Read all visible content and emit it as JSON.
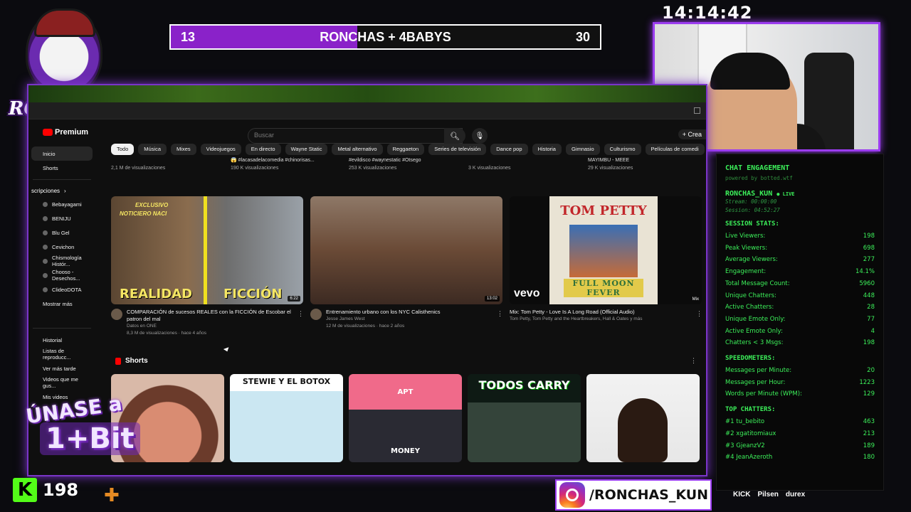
{
  "overlay": {
    "clock": "14:14:42",
    "score": {
      "left": "13",
      "title": "RONCHAS + 4BABYS",
      "right": "30"
    },
    "logo_text": "RONCHAS",
    "join_line1": "ÚNASE a",
    "join_line2": "1+Bit",
    "kick_count": "198",
    "instagram": "/RONCHAS_KUN",
    "sponsors": [
      "KICK",
      "Pilsen",
      "durex"
    ]
  },
  "youtube": {
    "brand": "Premium",
    "search_placeholder": "Buscar",
    "create_label": "+ Crea",
    "sidebar": {
      "main": [
        "Inicio",
        "Shorts"
      ],
      "subscriptions_header": "scripciones",
      "subscriptions": [
        "Bebayagami",
        "BENIJU",
        "Blu Gel",
        "Cevichon",
        "Chismología Histór...",
        "Chooso - Desechos...",
        "ClideoDOTA"
      ],
      "show_more": "Mostrar más",
      "you": [
        "Historial",
        "Listas de reproducc...",
        "Ver más tarde",
        "Videos que me gus...",
        "Mis videos"
      ]
    },
    "chips": [
      "Todo",
      "Música",
      "Mixes",
      "Videojuegos",
      "En directo",
      "Wayne Static",
      "Metal alternativo",
      "Reggaeton",
      "Series de televisión",
      "Dance pop",
      "Historia",
      "Gimnasio",
      "Culturismo",
      "Películas de comedi"
    ],
    "previous_row": [
      {
        "title": "",
        "meta": "2,1 M de visualizaciones"
      },
      {
        "title": "😱 #lacasadelacomedia #chinorisas...",
        "meta": "190 K visualizaciones"
      },
      {
        "title": "#evildisco #waynestatic #Otsego",
        "meta": "253 K visualizaciones"
      },
      {
        "title": "",
        "meta": "3 K visualizaciones"
      },
      {
        "title": "MAYIMBU - MEEE",
        "meta": "29 K visualizaciones"
      }
    ],
    "videos": [
      {
        "title": "COMPARACIÓN de sucesos REALES con la FICCIÓN de Escobar el patron del mal",
        "channel": "Datos en ONE",
        "meta": "8,3 M de visualizaciones · hace 4 años",
        "duration": "6:22",
        "thumb_text": [
          "EXCLUSIVO",
          "NOTICIERO",
          "NACI",
          "REALIDAD",
          "FICCIÓN"
        ]
      },
      {
        "title": "Entrenamiento urbano con los NYC Calisthenics",
        "channel": "Jesse James West",
        "meta": "12 M de visualizaciones · hace 2 años",
        "duration": "13:02",
        "thumb_text": []
      },
      {
        "title": "Mix: Tom Petty - Love Is A Long Road (Official Audio)",
        "channel": "Tom Petty, Tom Petty and the Heartbreakers, Hall & Oates y más",
        "meta": "",
        "duration": "Mix",
        "thumb_text": [
          "TOM PETTY",
          "FULL MOON FEVER",
          "vevo"
        ]
      }
    ],
    "shorts_header": "Shorts",
    "shorts": [
      {
        "caption": ""
      },
      {
        "caption": "STEWIE Y EL BOTOX"
      },
      {
        "caption": "APT",
        "caption2": "MONEY"
      },
      {
        "caption": "TODOS CARRY"
      },
      {
        "caption": ""
      }
    ]
  },
  "chat_panel": {
    "title": "CHAT ENGAGEMENT",
    "subtitle": "powered by botted.wtf",
    "user": "RONCHAS_KUN",
    "live_label": "● LIVE",
    "stream_time": "Stream: 00:00:00",
    "session_time": "Session: 04:52:27",
    "session_stats_title": "SESSION STATS:",
    "session_stats": [
      {
        "label": "Live Viewers:",
        "value": "198"
      },
      {
        "label": "Peak Viewers:",
        "value": "698"
      },
      {
        "label": "Average Viewers:",
        "value": "277"
      },
      {
        "label": "Engagement:",
        "value": "14.1%"
      },
      {
        "label": "Total Message Count:",
        "value": "5960"
      },
      {
        "label": "Unique Chatters:",
        "value": "448"
      },
      {
        "label": "Active Chatters:",
        "value": "28"
      },
      {
        "label": "Unique Emote Only:",
        "value": "77"
      },
      {
        "label": "Active Emote Only:",
        "value": "4"
      },
      {
        "label": "Chatters < 3 Msgs:",
        "value": "198"
      }
    ],
    "speedometers_title": "SPEEDOMETERS:",
    "speedometers": [
      {
        "label": "Messages per Minute:",
        "value": "20"
      },
      {
        "label": "Messages per Hour:",
        "value": "1223"
      },
      {
        "label": "Words per Minute (WPM):",
        "value": "129"
      }
    ],
    "top_chatters_title": "TOP CHATTERS:",
    "top_chatters": [
      {
        "label": "#1 tu_bebito",
        "value": "463"
      },
      {
        "label": "#2 xgatitomiaux",
        "value": "213"
      },
      {
        "label": "#3 GjeanzV2",
        "value": "189"
      },
      {
        "label": "#4 JeanAzeroth",
        "value": "180"
      }
    ]
  }
}
